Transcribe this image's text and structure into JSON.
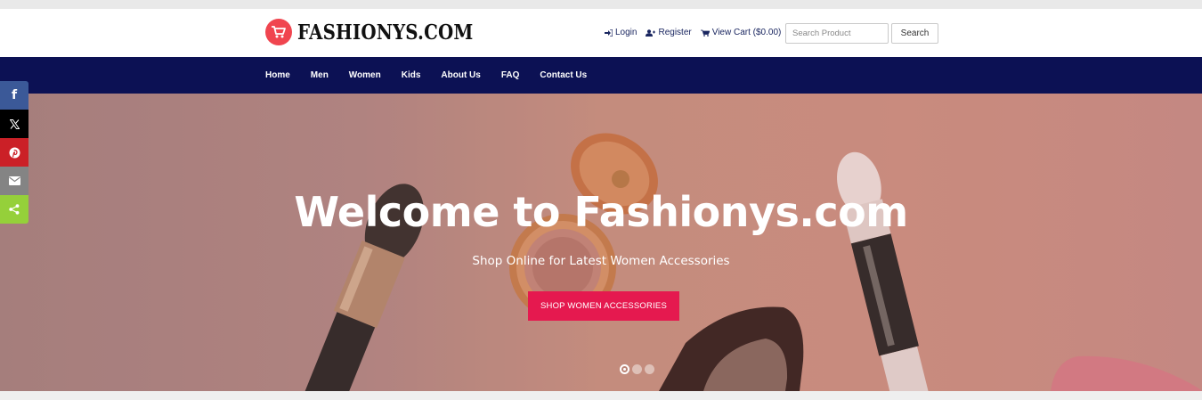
{
  "brand": {
    "name": "FASHIONYS.COM",
    "accent": "#f0454f"
  },
  "header": {
    "links": [
      {
        "label": "Login",
        "icon": "login-icon"
      },
      {
        "label": "Register",
        "icon": "user-plus-icon"
      },
      {
        "label": "View Cart ($0.00)",
        "icon": "cart-icon"
      }
    ],
    "search_placeholder": "Search Product",
    "search_button": "Search"
  },
  "nav": {
    "background": "#0c1154",
    "items": [
      "Home",
      "Men",
      "Women",
      "Kids",
      "About Us",
      "FAQ",
      "Contact Us"
    ]
  },
  "hero": {
    "title": "Welcome to Fashionys.com",
    "subtitle": "Shop Online for Latest Women Accessories",
    "cta": "SHOP WOMEN ACCESSORIES",
    "cta_color": "#e5194f",
    "slides_total": 3,
    "active_slide": 1
  },
  "share_bar": [
    {
      "name": "facebook-icon",
      "color": "#3b5998"
    },
    {
      "name": "x-twitter-icon",
      "color": "#000000"
    },
    {
      "name": "pinterest-icon",
      "color": "#cb2027"
    },
    {
      "name": "email-icon",
      "color": "#848484"
    },
    {
      "name": "share-icon",
      "color": "#95d03a"
    }
  ]
}
